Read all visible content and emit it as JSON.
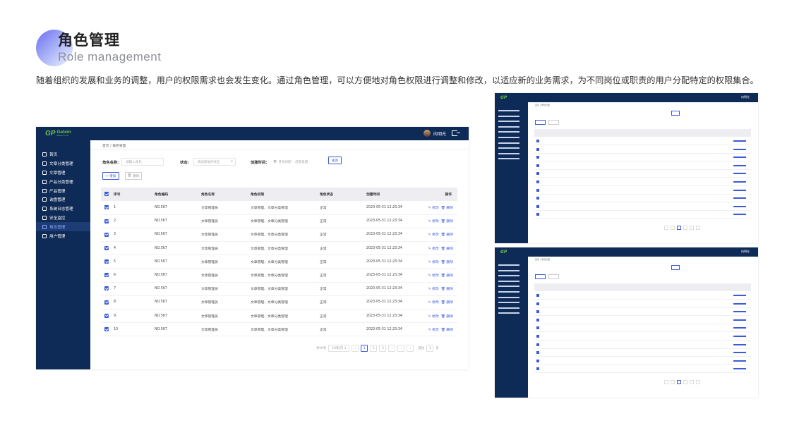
{
  "header": {
    "title": "角色管理",
    "subtitle": "Role management",
    "description": "随着组织的发展和业务的调整，用户的权限需求也会发生变化。通过角色管理，可以方便地对角色权限进行调整和修改，以适应新的业务需求，为不同岗位或职责的用户分配特定的权限集合。"
  },
  "app": {
    "logo_mark": "GP",
    "logo_name": "Getein",
    "logo_sub": "Biotech,Inc.",
    "user_name": "向明光",
    "breadcrumb": "首页 / 角色管理",
    "sidebar": [
      {
        "label": "首页",
        "icon": "home-icon"
      },
      {
        "label": "文章分类管理",
        "icon": "book-icon"
      },
      {
        "label": "文章管理",
        "icon": "document-icon"
      },
      {
        "label": "产品分类管理",
        "icon": "gear-icon"
      },
      {
        "label": "产品管理",
        "icon": "cube-icon"
      },
      {
        "label": "询盘管理",
        "icon": "inbox-icon"
      },
      {
        "label": "系统日志管理",
        "icon": "grid-icon"
      },
      {
        "label": "安全监控",
        "icon": "shield-icon"
      },
      {
        "label": "角色管理",
        "icon": "user-icon",
        "active": true
      },
      {
        "label": "用户管理",
        "icon": "users-icon"
      }
    ],
    "filters": {
      "role_name_label": "角色名称:",
      "role_name_placeholder": "请输入角色",
      "status_label": "状态:",
      "status_placeholder": "请选择角色状态",
      "created_label": "创建时间:",
      "date_start_placeholder": "开始日期",
      "date_sep": "-",
      "date_end_placeholder": "结束日期",
      "query_button": "查询"
    },
    "add_button": "+ 增加",
    "delete_button": "删除",
    "table": {
      "columns": [
        "序号",
        "角色编码",
        "角色名称",
        "角色权限",
        "角色状态",
        "创建时间",
        "操作"
      ],
      "rows": [
        [
          "1",
          "NO.567",
          "文章管理员",
          "文章管理、文章分类管理",
          "正常",
          "2023-05-31 12:23:34"
        ],
        [
          "2",
          "NO.567",
          "文章管理员",
          "文章管理、文章分类管理",
          "正常",
          "2023-05-31 12:23:34"
        ],
        [
          "3",
          "NO.567",
          "文章管理员",
          "文章管理、文章分类管理",
          "正常",
          "2023-05-31 12:23:34"
        ],
        [
          "4",
          "NO.567",
          "文章管理员",
          "文章管理、文章分类管理",
          "正常",
          "2023-05-31 12:23:34"
        ],
        [
          "5",
          "NO.567",
          "文章管理员",
          "文章管理、文章分类管理",
          "正常",
          "2023-05-31 12:23:34"
        ],
        [
          "6",
          "NO.567",
          "文章管理员",
          "文章管理、文章分类管理",
          "正常",
          "2023-05-31 12:23:34"
        ],
        [
          "7",
          "NO.567",
          "文章管理员",
          "文章管理、文章分类管理",
          "正常",
          "2023-05-31 12:23:34"
        ],
        [
          "8",
          "NO.567",
          "文章管理员",
          "文章管理、文章分类管理",
          "正常",
          "2023-05-31 12:23:34"
        ],
        [
          "9",
          "NO.567",
          "文章管理员",
          "文章管理、文章分类管理",
          "正常",
          "2023-05-31 12:23:34"
        ],
        [
          "10",
          "NO.567",
          "文章管理员",
          "文章管理、文章分类管理",
          "正常",
          "2023-05-31 12:23:34"
        ]
      ],
      "edit_label": "✎ 修改",
      "delete_label": "🗑 删除"
    },
    "pager": {
      "total": "共10条",
      "page_size": "10条/页",
      "pages": [
        "‹",
        "1",
        "2",
        "3",
        "···",
        "›",
        "›"
      ],
      "goto_label": "前往",
      "goto_value": "1",
      "goto_suffix": "页"
    }
  }
}
